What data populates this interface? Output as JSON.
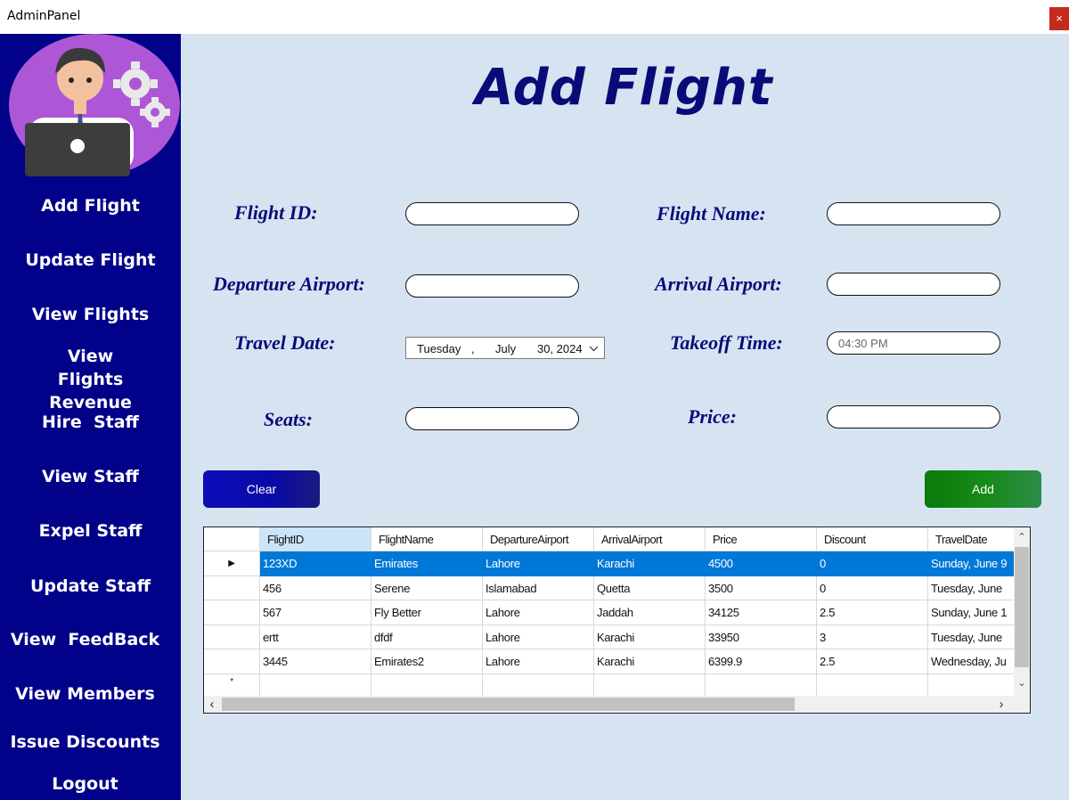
{
  "window": {
    "title": "AdminPanel",
    "close_label": "×"
  },
  "sidebar": {
    "items": [
      {
        "label": "Add Flight"
      },
      {
        "label": "Update Flight"
      },
      {
        "label": "View Flights"
      },
      {
        "label": "View Flights Revenue"
      },
      {
        "label": "Hire  Staff"
      },
      {
        "label": "View Staff"
      },
      {
        "label": "Expel Staff"
      },
      {
        "label": "Update Staff"
      },
      {
        "label": "View  FeedBack"
      },
      {
        "label": "View Members"
      },
      {
        "label": "Issue Discounts"
      },
      {
        "label": "Logout"
      }
    ]
  },
  "main": {
    "title": "Add Flight",
    "form": {
      "flight_id_label": "Flight ID:",
      "flight_id_value": "",
      "flight_name_label": "Flight Name:",
      "flight_name_value": "",
      "departure_label": "Departure Airport:",
      "departure_value": "",
      "arrival_label": "Arrival Airport:",
      "arrival_value": "",
      "travel_date_label": "Travel Date:",
      "travel_date": {
        "day": "Tuesday",
        "sep": ",",
        "month": "July",
        "date": "30, 2024"
      },
      "takeoff_label": "Takeoff Time:",
      "takeoff_value": "04:30 PM",
      "seats_label": "Seats:",
      "seats_value": "",
      "price_label": "Price:",
      "price_value": ""
    },
    "buttons": {
      "clear": "Clear",
      "add": "Add"
    },
    "grid": {
      "columns": [
        "FlightID",
        "FlightName",
        "DepartureAirport",
        "ArrivalAirport",
        "Price",
        "Discount",
        "TravelDate"
      ],
      "rows": [
        [
          "123XD",
          "Emirates",
          "Lahore",
          "Karachi",
          "4500",
          "0",
          "Sunday, June 9"
        ],
        [
          "456",
          "Serene",
          "Islamabad",
          "Quetta",
          "3500",
          "0",
          "Tuesday, June"
        ],
        [
          "567",
          "Fly Better",
          "Lahore",
          "Jaddah",
          "34125",
          "2.5",
          "Sunday, June 1"
        ],
        [
          "ertt",
          "dfdf",
          "Lahore",
          "Karachi",
          "33950",
          "3",
          "Tuesday, June"
        ],
        [
          "3445",
          "Emirates2",
          "Lahore",
          "Karachi",
          "6399.9",
          "2.5",
          "Wednesday, Ju"
        ]
      ],
      "selected_row_marker": "▶",
      "new_row_marker": "*"
    }
  }
}
